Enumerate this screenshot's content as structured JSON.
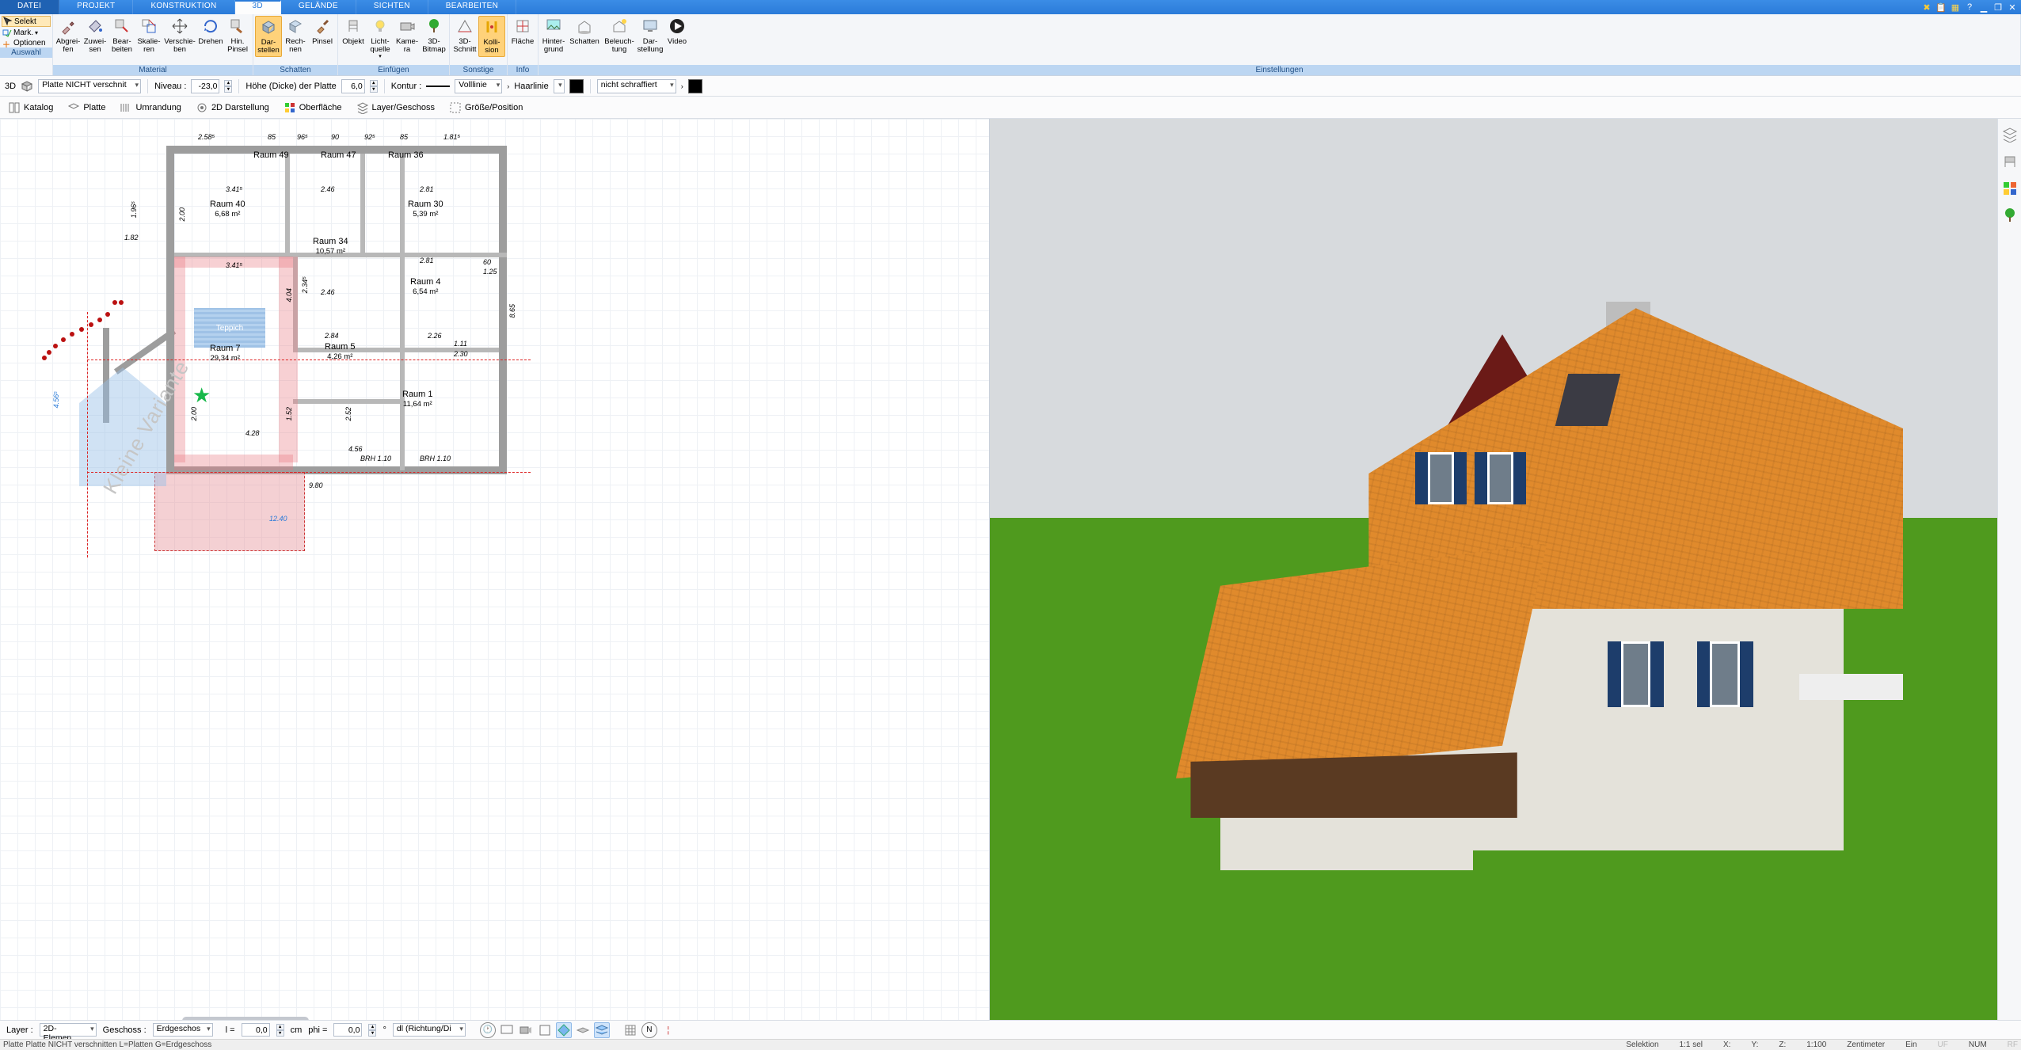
{
  "menu": {
    "tabs": [
      "DATEI",
      "PROJEKT",
      "KONSTRUKTION",
      "3D",
      "GELÄNDE",
      "SICHTEN",
      "BEARBEITEN"
    ],
    "active": 3
  },
  "selection_col": {
    "sel": "Selekt",
    "mark": "Mark.",
    "opt": "Optionen"
  },
  "ribbon": {
    "auswahl": "Auswahl",
    "material": {
      "label": "Material",
      "b1": "Abgrei-\nfen",
      "b2": "Zuwei-\nsen",
      "b3": "Bear-\nbeiten",
      "b4": "Skalie-\nren",
      "b5": "Verschie-\nben",
      "b6": "Drehen",
      "b7": "Hin.\nPinsel"
    },
    "schatten": {
      "label": "Schatten",
      "b1": "Dar-\nstellen",
      "b2": "Rech-\nnen",
      "b3": "Pinsel"
    },
    "einfuegen": {
      "label": "Einfügen",
      "b1": "Objekt",
      "b2": "Licht-\nquelle",
      "b3": "Kame-\nra",
      "b4": "3D-\nBitmap"
    },
    "sonstige": {
      "label": "Sonstige",
      "b1": "3D-\nSchnitt",
      "b2": "Kolli-\nsion"
    },
    "info": {
      "label": "Info",
      "b1": "Fläche"
    },
    "einstellungen": {
      "label": "Einstellungen",
      "b1": "Hinter-\ngrund",
      "b2": "Schatten",
      "b3": "Beleuch-\ntung",
      "b4": "Dar-\nstellung",
      "b5": "Video"
    }
  },
  "optbar": {
    "mode": "3D",
    "platte": "Platte NICHT verschnit",
    "niveau": "Niveau :",
    "niveau_v": "-23,0",
    "hoehe": "Höhe (Dicke) der Platte",
    "hoehe_v": "6,0",
    "kontur": "Kontur :",
    "line1": "Volllinie",
    "haarlinie": "Haarlinie",
    "schraff": "nicht schraffiert"
  },
  "toolbar2": {
    "katalog": "Katalog",
    "platte": "Platte",
    "umrandung": "Umrandung",
    "darst": "2D Darstellung",
    "ober": "Oberfläche",
    "layer": "Layer/Geschoss",
    "groesse": "Größe/Position"
  },
  "plan": {
    "rooms": {
      "r49": "Raum 49",
      "r47": "Raum 47",
      "r36": "Raum 36",
      "r40": "Raum 40",
      "r40s": "6,68 m²",
      "r34": "Raum 34",
      "r34s": "10,57 m²",
      "r30": "Raum 30",
      "r30s": "5,39 m²",
      "r4": "Raum 4",
      "r4s": "6,54 m²",
      "r5": "Raum 5",
      "r5s": "4,26 m²",
      "r1": "Raum 1",
      "r1s": "11,64 m²",
      "r7": "Raum 7",
      "r7s": "29,34 m²",
      "teppich": "Teppich",
      "variante": "Kleine Variante"
    },
    "dims": {
      "t1": "2.58⁵",
      "t2": "85",
      "t3": "96⁵",
      "t4": "90",
      "t5": "92⁵",
      "t6": "85",
      "t7": "1.81⁵",
      "d200": "2.00",
      "d341": "3.41⁵",
      "d246": "2.46",
      "d281": "2.81",
      "d404": "4.04",
      "d234": "2.34⁵",
      "d284": "2.84",
      "d226": "2.26",
      "d252": "2.52",
      "d428": "4.28",
      "d456": "4.56",
      "d182": "1.82",
      "d196": "1.96⁵",
      "d125": "1.25",
      "d60": "60",
      "d865": "8.65",
      "d980": "9.80",
      "d1240": "12.40",
      "d111": "1.11",
      "d230": "2.30",
      "d152": "1.52",
      "brh": "BRH 1.10",
      "d456v": "4.56⁵"
    }
  },
  "bottom": {
    "layer": "Layer :",
    "layer_v": "2D-Elemen",
    "geschoss": "Geschoss :",
    "geschoss_v": "Erdgeschos",
    "l": "l =",
    "l_v": "0,0",
    "cm": "cm",
    "phi": "phi =",
    "phi_v": "0,0",
    "deg": "°",
    "mode": "dl (Richtung/Di"
  },
  "status": {
    "left": "Platte Platte NICHT verschnitten L=Platten G=Erdgeschoss",
    "sel": "Selektion",
    "sel2": "1:1 sel",
    "x": "X:",
    "y": "Y:",
    "z": "Z:",
    "scale": "1:100",
    "unit": "Zentimeter",
    "ein": "Ein",
    "uf": "UF",
    "num": "NUM",
    "rf": "RF"
  }
}
